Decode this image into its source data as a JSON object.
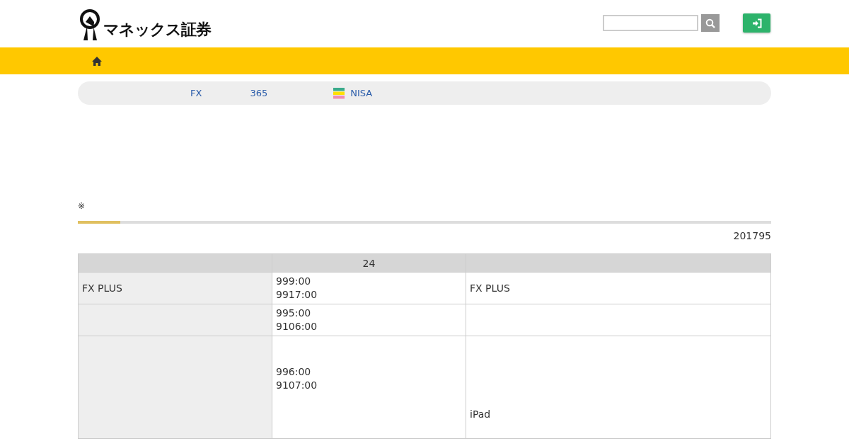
{
  "header": {
    "logo_text": "マネックス証券"
  },
  "breadcrumb": [
    {
      "label": "FX",
      "kind": "text"
    },
    {
      "label": "365",
      "kind": "text"
    },
    {
      "label": "NISA",
      "kind": "flag"
    }
  ],
  "note": "※",
  "date": "201795",
  "table": {
    "columns": [
      null,
      "24",
      null
    ],
    "rows": [
      {
        "cells": [
          "FX PLUS",
          [
            "999:00",
            "9917:00"
          ],
          "FX PLUS"
        ]
      },
      {
        "cells": [
          null,
          [
            "995:00",
            "9106:00"
          ],
          null
        ]
      },
      {
        "cells": [
          null,
          [
            "996:00",
            "9107:00"
          ],
          "iPad"
        ]
      }
    ]
  }
}
